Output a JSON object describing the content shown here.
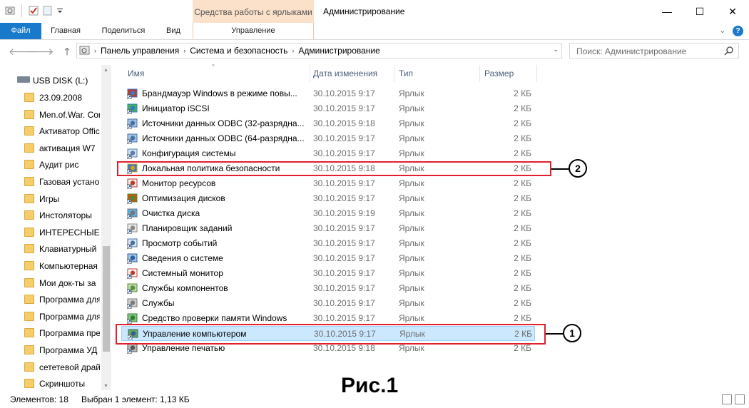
{
  "window": {
    "title": "Администрирование",
    "context_tab": "Средства работы с ярлыками",
    "minimize": "—",
    "maximize": "☐",
    "close": "✕"
  },
  "ribbon": {
    "tabs": [
      "Файл",
      "Главная",
      "Поделиться",
      "Вид",
      "Управление"
    ],
    "collapse": "⌄",
    "help": "?"
  },
  "address": {
    "crumbs": [
      "Панель управления",
      "Система и безопасность",
      "Администрирование"
    ],
    "search_placeholder": "Поиск: Администрирование"
  },
  "nav": {
    "drive": "USB DISK (L:)",
    "folders": [
      "23.09.2008",
      "Men.of.War. Cor",
      "Активатор Offic",
      "активация W7",
      "Аудит рис",
      "Газовая установ",
      "Игры",
      "Инстоляторы",
      "ИНТЕРЕСНЫЕ Г",
      "Клавиатурный",
      "Компьютерная",
      "Мои док-ты за",
      "Программа для",
      "Программа для",
      "Программа пре",
      "Программа УД",
      "сететевой драй",
      "Скриншоты"
    ]
  },
  "columns": {
    "name": "Имя",
    "date": "Дата изменения",
    "type": "Тип",
    "size": "Размер"
  },
  "files": [
    {
      "name": "Брандмауэр Windows в режиме повы...",
      "date": "30.10.2015 9:17",
      "type": "Ярлык",
      "size": "2 КБ",
      "icon": "firewall-icon"
    },
    {
      "name": "Инициатор iSCSI",
      "date": "30.10.2015 9:17",
      "type": "Ярлык",
      "size": "2 КБ",
      "icon": "iscsi-icon"
    },
    {
      "name": "Источники данных ODBC (32-разрядна...",
      "date": "30.10.2015 9:18",
      "type": "Ярлык",
      "size": "2 КБ",
      "icon": "odbc-icon"
    },
    {
      "name": "Источники данных ODBC (64-разрядна...",
      "date": "30.10.2015 9:17",
      "type": "Ярлык",
      "size": "2 КБ",
      "icon": "odbc-icon"
    },
    {
      "name": "Конфигурация системы",
      "date": "30.10.2015 9:17",
      "type": "Ярлык",
      "size": "2 КБ",
      "icon": "msconfig-icon"
    },
    {
      "name": "Локальная политика безопасности",
      "date": "30.10.2015 9:18",
      "type": "Ярлык",
      "size": "2 КБ",
      "icon": "security-policy-icon"
    },
    {
      "name": "Монитор ресурсов",
      "date": "30.10.2015 9:17",
      "type": "Ярлык",
      "size": "2 КБ",
      "icon": "resource-monitor-icon"
    },
    {
      "name": "Оптимизация дисков",
      "date": "30.10.2015 9:17",
      "type": "Ярлык",
      "size": "2 КБ",
      "icon": "defrag-icon"
    },
    {
      "name": "Очистка диска",
      "date": "30.10.2015 9:19",
      "type": "Ярлык",
      "size": "2 КБ",
      "icon": "disk-cleanup-icon"
    },
    {
      "name": "Планировщик заданий",
      "date": "30.10.2015 9:17",
      "type": "Ярлык",
      "size": "2 КБ",
      "icon": "task-scheduler-icon"
    },
    {
      "name": "Просмотр событий",
      "date": "30.10.2015 9:17",
      "type": "Ярлык",
      "size": "2 КБ",
      "icon": "event-viewer-icon"
    },
    {
      "name": "Сведения о системе",
      "date": "30.10.2015 9:17",
      "type": "Ярлык",
      "size": "2 КБ",
      "icon": "system-info-icon"
    },
    {
      "name": "Системный монитор",
      "date": "30.10.2015 9:17",
      "type": "Ярлык",
      "size": "2 КБ",
      "icon": "perf-monitor-icon"
    },
    {
      "name": "Службы компонентов",
      "date": "30.10.2015 9:17",
      "type": "Ярлык",
      "size": "2 КБ",
      "icon": "component-services-icon"
    },
    {
      "name": "Службы",
      "date": "30.10.2015 9:17",
      "type": "Ярлык",
      "size": "2 КБ",
      "icon": "services-icon"
    },
    {
      "name": "Средство проверки памяти Windows",
      "date": "30.10.2015 9:17",
      "type": "Ярлык",
      "size": "2 КБ",
      "icon": "memory-diagnostic-icon"
    },
    {
      "name": "Управление компьютером",
      "date": "30.10.2015 9:17",
      "type": "Ярлык",
      "size": "2 КБ",
      "icon": "computer-management-icon",
      "selected": true
    },
    {
      "name": "Управление печатью",
      "date": "30.10.2015 9:18",
      "type": "Ярлык",
      "size": "2 КБ",
      "icon": "print-management-icon"
    }
  ],
  "annotations": {
    "callout_1": "1",
    "callout_2": "2",
    "caption": "Рис.1"
  },
  "status": {
    "items": "Элементов: 18",
    "selected": "Выбран 1 элемент: 1,13 КБ"
  },
  "colors": {
    "accent": "#1979ca",
    "context_tab": "#fbe1c9",
    "selection": "#cce8ff",
    "highlight_box": "#e0202c"
  }
}
